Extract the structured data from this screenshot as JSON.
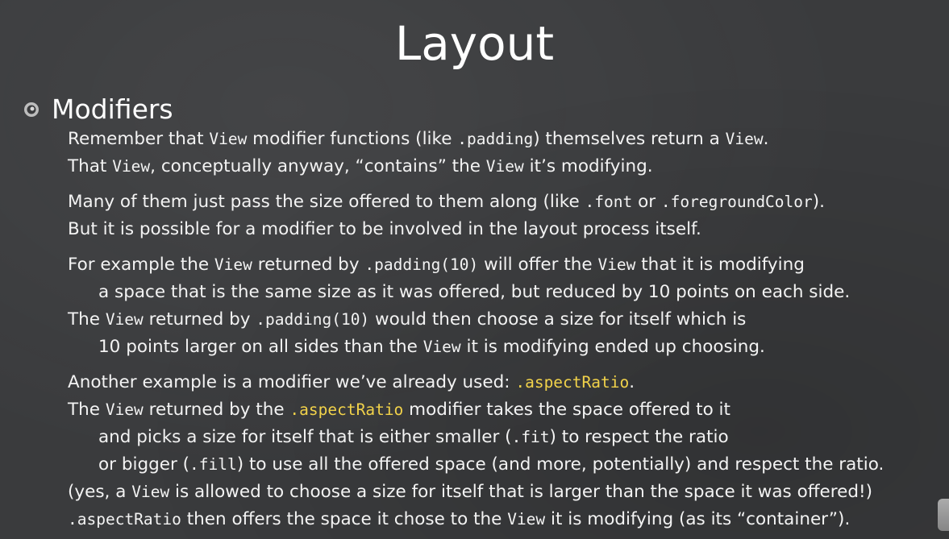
{
  "slide": {
    "title": "Layout",
    "heading": "Modifiers",
    "colors": {
      "background": "#3a3b3d",
      "text": "#f3f3f3",
      "highlight": "#f1d24a"
    },
    "bullet_icon": "eye-bullet-icon",
    "p1": {
      "l1_a": "Remember that ",
      "l1_b": "View",
      "l1_c": " modifier functions (like ",
      "l1_d": ".padding",
      "l1_e": ") themselves return a ",
      "l1_f": "View",
      "l1_g": ".",
      "l2_a": "That ",
      "l2_b": "View",
      "l2_c": ", conceptually anyway, “contains” the ",
      "l2_d": "View",
      "l2_e": " it’s modifying."
    },
    "p2": {
      "l1_a": "Many of them just pass the size offered to them along (like ",
      "l1_b": ".font",
      "l1_c": " or ",
      "l1_d": ".foregroundColor",
      "l1_e": ").",
      "l2": "But it is possible for a modifier to be involved in the layout process itself."
    },
    "p3": {
      "l1_a": "For example the ",
      "l1_b": "View",
      "l1_c": " returned by ",
      "l1_d": ".padding(10)",
      "l1_e": " will offer the ",
      "l1_f": "View",
      "l1_g": " that it is modifying",
      "l2": "a space that is the same size as it was offered, but reduced by 10 points on each side.",
      "l3_a": "The ",
      "l3_b": "View",
      "l3_c": " returned by ",
      "l3_d": ".padding(10)",
      "l3_e": " would then choose a size for itself which is",
      "l4_a": "10 points larger on all sides than the ",
      "l4_b": "View",
      "l4_c": " it is modifying ended up choosing."
    },
    "p4": {
      "l1_a": "Another example is a modifier we’ve already used: ",
      "l1_b": ".aspectRatio",
      "l1_c": ".",
      "l2_a": "The ",
      "l2_b": "View",
      "l2_c": " returned by the ",
      "l2_d": ".aspectRatio",
      "l2_e": " modifier takes the space offered to it",
      "l3_a": "and picks a size for itself that is either smaller (",
      "l3_b": ".fit",
      "l3_c": ") to respect the ratio",
      "l4_a": "or bigger (",
      "l4_b": ".fill",
      "l4_c": ") to use all the offered space (and more, potentially) and respect the ratio.",
      "l5_a": "(yes, a ",
      "l5_b": "View",
      "l5_c": " is allowed to choose a size for itself that is larger than the space it was offered!)",
      "l6_a": ".aspectRatio",
      "l6_b": " then offers the space it chose to the ",
      "l6_c": "View",
      "l6_d": " it is modifying (as its “container”)."
    }
  }
}
